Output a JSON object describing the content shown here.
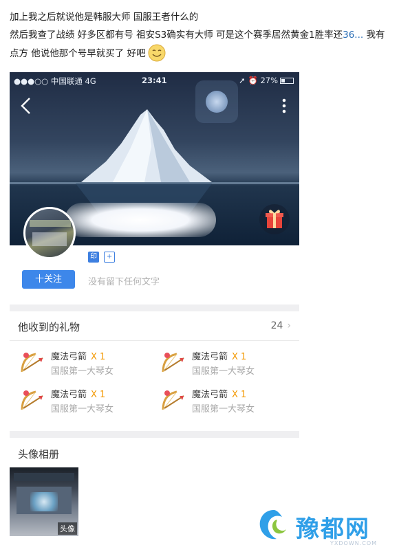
{
  "post": {
    "line1": "加上我之后就说他是韩服大师 国服王者什么的",
    "line2_a": "然后我查了战绩 好多区都有号 祖安S3确实有大师 可是这个赛季居然黄金1胜率还",
    "line2_highlight": "36...",
    "line2_b": " 我有",
    "line3": "点方 他说他那个号早就买了 好吧"
  },
  "statusbar": {
    "carrier": "●●●○○ 中国联通  4G",
    "time": "23:41",
    "right": "➚ ⏰ 27%"
  },
  "profile": {
    "badge_label": "印",
    "badge_plus": "+",
    "follow_label": "十关注",
    "bio": "没有留下任何文字"
  },
  "gifts": {
    "title": "他收到的礼物",
    "count": "24",
    "chevron": "›",
    "items": [
      {
        "name": "魔法弓箭",
        "qty": "X 1",
        "from": "国服第一大琴女"
      },
      {
        "name": "魔法弓箭",
        "qty": "X 1",
        "from": "国服第一大琴女"
      },
      {
        "name": "魔法弓箭",
        "qty": "X 1",
        "from": "国服第一大琴女"
      },
      {
        "name": "魔法弓箭",
        "qty": "X 1",
        "from": "国服第一大琴女"
      }
    ]
  },
  "album": {
    "title": "头像相册",
    "thumb_label": "头像"
  },
  "watermark": {
    "text": "豫都网",
    "sub": "YXDOWN.COM"
  },
  "icons": [
    "smiley-icon",
    "back-icon",
    "more-icon",
    "moon-icon",
    "gift-icon",
    "bow-arrow-icon",
    "site-logo-icon"
  ],
  "colors": {
    "accent": "#3d87ea",
    "qty": "#f39800",
    "link": "#2a6db5",
    "watermark": "#2f9fe8"
  }
}
